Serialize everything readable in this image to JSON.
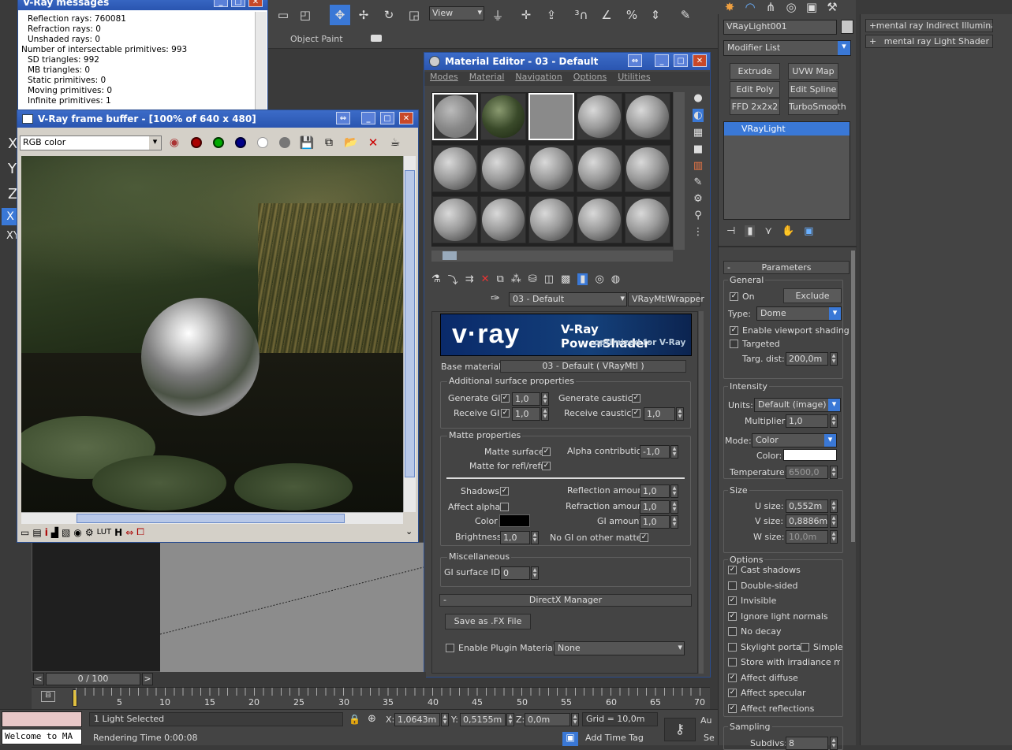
{
  "main_toolbar": {
    "view_dropdown": "View",
    "object_paint": "Object Paint"
  },
  "vray_messages": {
    "title": "V-Ray messages",
    "lines": [
      "Reflection rays: 760081",
      "Refraction rays: 0",
      "Unshaded rays: 0",
      "Number of intersectable primitives: 993",
      "SD triangles: 992",
      "MB triangles: 0",
      "Static primitives: 0",
      "Moving primitives: 0",
      "Infinite primitives: 1"
    ]
  },
  "frame_buffer": {
    "title": "V-Ray frame buffer - [100% of 640 x 480]",
    "channel": "RGB color"
  },
  "material_editor": {
    "title": "Material Editor - 03 - Default",
    "menus": [
      "Modes",
      "Material",
      "Navigation",
      "Options",
      "Utilities"
    ],
    "material_name": "03 - Default",
    "material_type": "VRayMtlWrapper",
    "banner_logo": "v·ray",
    "banner_title": "V-Ray PowerShader",
    "banner_sub": "optimized for V-Ray",
    "base_material_label": "Base material:",
    "base_material_value": "03 - Default  ( VRayMtl )",
    "additional": {
      "title": "Additional surface properties",
      "generate_gi": "Generate GI",
      "generate_gi_val": "1,0",
      "receive_gi": "Receive GI",
      "receive_gi_val": "1,0",
      "generate_caustics": "Generate caustics",
      "receive_caustics": "Receive caustics",
      "receive_caustics_val": "1,0"
    },
    "matte": {
      "title": "Matte properties",
      "matte_surface": "Matte surface",
      "alpha_contribution": "Alpha contribution",
      "alpha_contribution_val": "-1,0",
      "matte_refl": "Matte for refl/refr",
      "shadows": "Shadows",
      "reflection_amount": "Reflection amount",
      "reflection_amount_val": "1,0",
      "affect_alpha": "Affect alpha",
      "refraction_amount": "Refraction amount",
      "refraction_amount_val": "1,0",
      "color": "Color",
      "gi_amount": "GI amount",
      "gi_amount_val": "1,0",
      "brightness": "Brightness",
      "brightness_val": "1,0",
      "no_gi": "No GI on other mattes"
    },
    "misc": {
      "title": "Miscellaneous",
      "gi_surface_id": "GI surface ID",
      "gi_surface_id_val": "0"
    },
    "directx": {
      "title": "DirectX Manager",
      "save_fx": "Save as .FX File",
      "enable_plugin": "Enable Plugin Material",
      "plugin_value": "None"
    }
  },
  "command_panel": {
    "object_name": "VRayLight001",
    "modifier_list": "Modifier List",
    "modifier_buttons": [
      "Extrude",
      "UVW Map",
      "Edit Poly",
      "Edit Spline",
      "FFD 2x2x2",
      "TurboSmooth"
    ],
    "stack_item": "VRayLight",
    "rollouts": [
      "mental ray Indirect Illumination",
      "mental ray Light Shader"
    ],
    "parameters": {
      "header": "Parameters",
      "general": "General",
      "on": "On",
      "exclude": "Exclude",
      "type_label": "Type:",
      "type_value": "Dome",
      "enable_viewport_shading": "Enable viewport shading",
      "targeted": "Targeted",
      "targ_dist_label": "Targ. dist:",
      "targ_dist_val": "200,0m",
      "intensity": "Intensity",
      "units_label": "Units:",
      "units_value": "Default (image)",
      "multiplier_label": "Multiplier:",
      "multiplier_val": "1,0",
      "mode_label": "Mode:",
      "mode_value": "Color",
      "color_label": "Color:",
      "temperature_label": "Temperature:",
      "temperature_val": "6500,0",
      "size": "Size",
      "u_size_label": "U size:",
      "u_size_val": "0,552m",
      "v_size_label": "V size:",
      "v_size_val": "0,8886m",
      "w_size_label": "W size:",
      "w_size_val": "10,0m",
      "options": "Options",
      "cast_shadows": "Cast shadows",
      "double_sided": "Double-sided",
      "invisible": "Invisible",
      "ignore_light_normals": "Ignore light normals",
      "no_decay": "No decay",
      "skylight_portal": "Skylight portal",
      "simple": "Simple",
      "store_irradiance": "Store with irradiance map",
      "affect_diffuse": "Affect diffuse",
      "affect_specular": "Affect specular",
      "affect_reflections": "Affect reflections",
      "sampling": "Sampling",
      "subdivs_label": "Subdivs:",
      "subdivs_val": "8"
    }
  },
  "timeline": {
    "frame_counter": "0 / 100",
    "ticks": [
      "5",
      "10",
      "15",
      "20",
      "25",
      "30",
      "35",
      "40",
      "45",
      "50",
      "55",
      "60",
      "65",
      "70"
    ]
  },
  "status_bar": {
    "maxscript": "Welcome to MA",
    "selection": "1 Light Selected",
    "render_time": "Rendering Time  0:00:08",
    "x_label": "X:",
    "x_val": "1,0643m",
    "y_label": "Y:",
    "y_val": "0,5155m",
    "z_label": "Z:",
    "z_val": "0,0m",
    "grid": "Grid = 10,0m",
    "add_time_tag": "Add Time Tag",
    "au": "Au",
    "se": "Se"
  },
  "viewport_axes": [
    "X",
    "Y",
    "Z",
    "X",
    "XY"
  ],
  "colors": {
    "titlebar": "#2a55b0",
    "ui_dark": "#444444",
    "selected_blue": "#3a78d6",
    "matte_color": "#000000",
    "light_color": "#ffffff"
  }
}
